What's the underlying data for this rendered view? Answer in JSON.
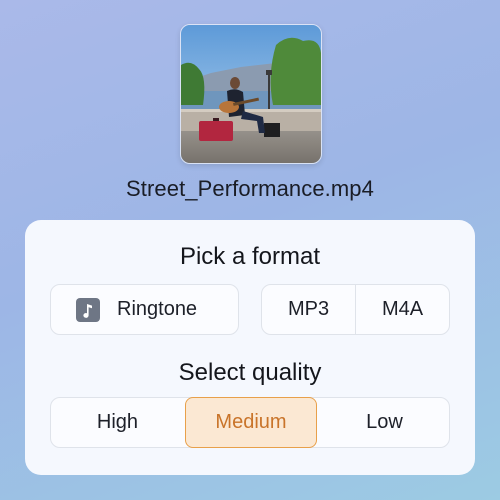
{
  "file": {
    "thumbnail_icon": "video-thumbnail",
    "name": "Street_Performance.mp4"
  },
  "format": {
    "title": "Pick a format",
    "ringtone": {
      "icon": "music-note-icon",
      "label": "Ringtone"
    },
    "options": [
      "MP3",
      "M4A"
    ]
  },
  "quality": {
    "title": "Select quality",
    "options": [
      "High",
      "Medium",
      "Low"
    ],
    "selected": "Medium"
  },
  "colors": {
    "selected_border": "#e8a04a",
    "selected_background": "#fbe8d3",
    "selected_text": "#c9742a",
    "panel": "#f5f8fe"
  }
}
